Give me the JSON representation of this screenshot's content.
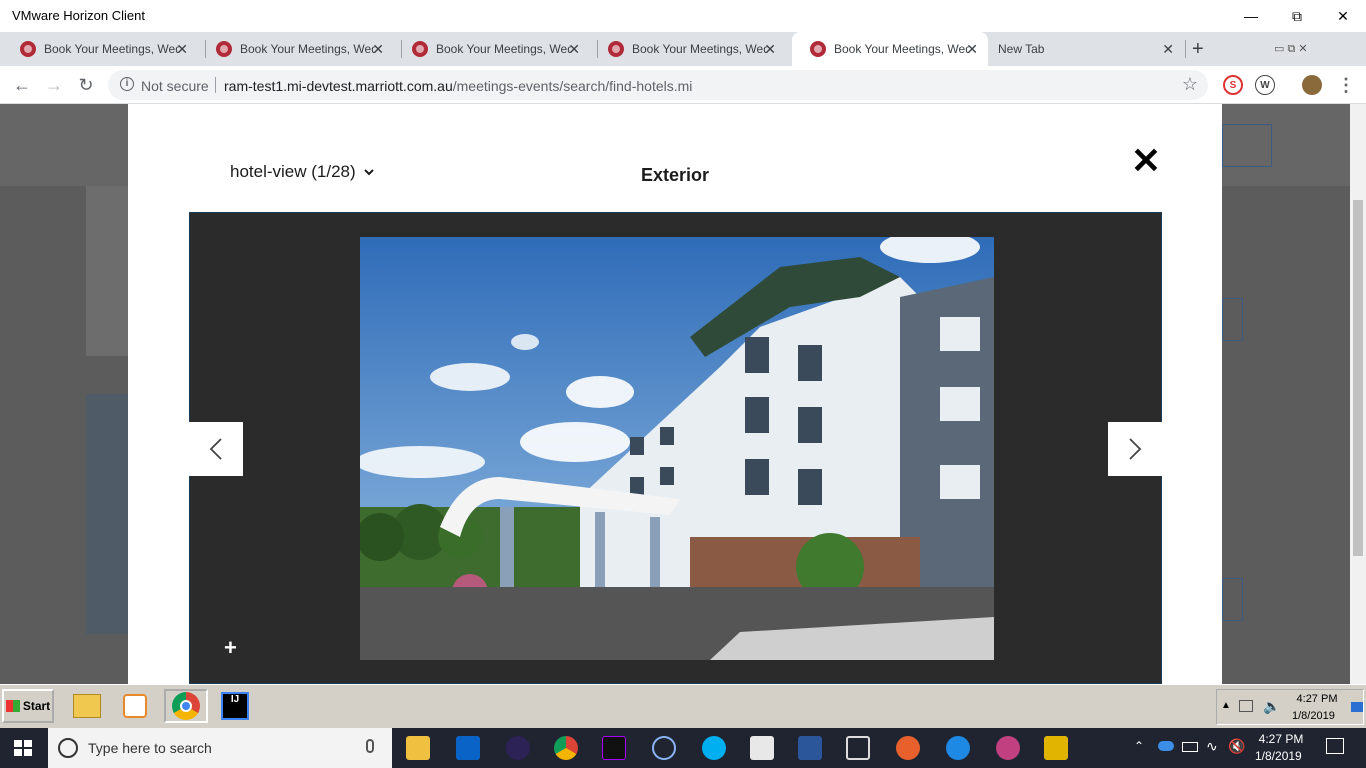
{
  "window": {
    "title": "VMware Horizon Client"
  },
  "tabs": [
    {
      "label": "Book Your Meetings, Weddi"
    },
    {
      "label": "Book Your Meetings, Weddi"
    },
    {
      "label": "Book Your Meetings, Weddi"
    },
    {
      "label": "Book Your Meetings, Weddi"
    },
    {
      "label": "Book Your Meetings, Weddi"
    },
    {
      "label": "New Tab"
    }
  ],
  "address": {
    "security": "Not secure",
    "host": "ram-test1.mi-devtest.marriott.com.au",
    "path": "/meetings-events/search/find-hotels.mi"
  },
  "modal": {
    "dropdown": "hotel-view (1/28)",
    "title": "Exterior"
  },
  "vdi_taskbar": {
    "start": "Start",
    "time": "4:27 PM",
    "date": "1/8/2019"
  },
  "host_taskbar": {
    "search_placeholder": "Type here to search",
    "time": "4:27 PM",
    "date": "1/8/2019"
  }
}
